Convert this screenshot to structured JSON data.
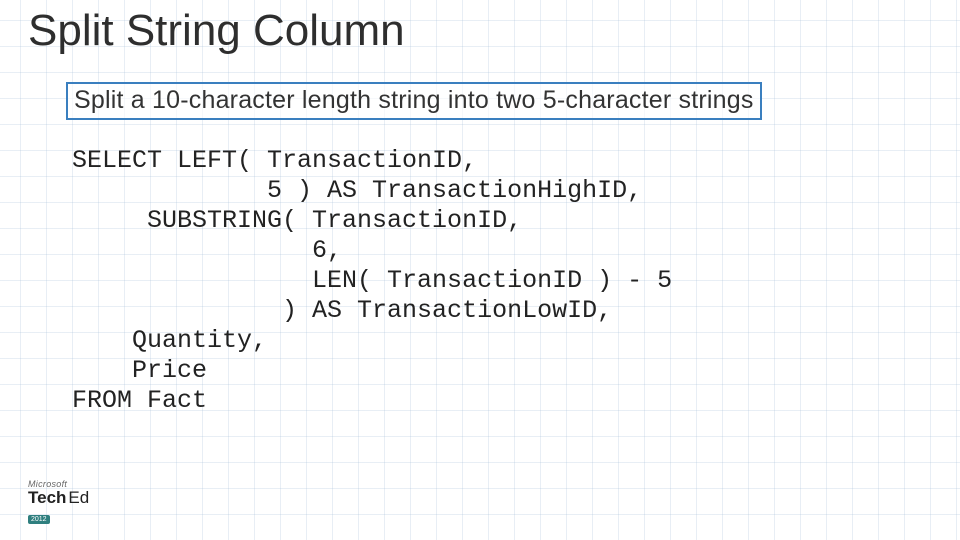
{
  "title": "Split String Column",
  "subtitle": "Split a 10-character length string into two 5-character strings",
  "code": "SELECT LEFT( TransactionID,\n             5 ) AS TransactionHighID,\n     SUBSTRING( TransactionID,\n                6,\n                LEN( TransactionID ) - 5\n              ) AS TransactionLowID,\n    Quantity,\n    Price\nFROM Fact",
  "footer": {
    "company": "Microsoft",
    "brand_part1": "Tech",
    "brand_part2": "Ed",
    "year": "2012"
  }
}
